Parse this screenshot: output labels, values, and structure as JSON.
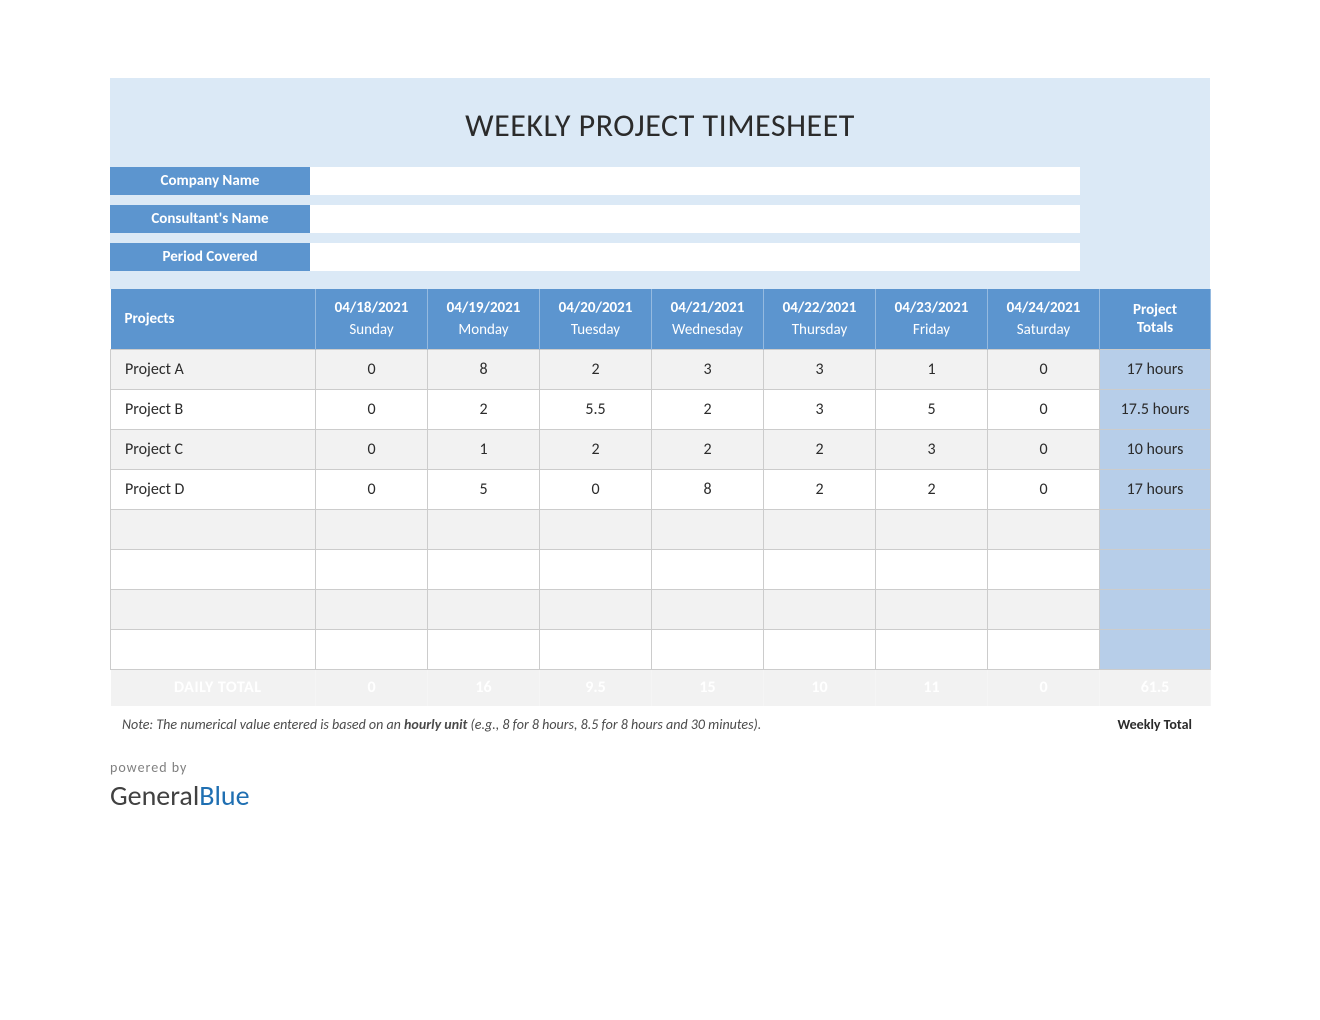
{
  "title": "WEEKLY PROJECT TIMESHEET",
  "meta": {
    "company_label": "Company Name",
    "consultant_label": "Consultant's Name",
    "period_label": "Period Covered",
    "company_value": "",
    "consultant_value": "",
    "period_value": ""
  },
  "table": {
    "projects_header": "Projects",
    "project_totals_header": "Project\nTotals",
    "columns": [
      {
        "date": "04/18/2021",
        "day": "Sunday"
      },
      {
        "date": "04/19/2021",
        "day": "Monday"
      },
      {
        "date": "04/20/2021",
        "day": "Tuesday"
      },
      {
        "date": "04/21/2021",
        "day": "Wednesday"
      },
      {
        "date": "04/22/2021",
        "day": "Thursday"
      },
      {
        "date": "04/23/2021",
        "day": "Friday"
      },
      {
        "date": "04/24/2021",
        "day": "Saturday"
      }
    ],
    "rows": [
      {
        "name": "Project A",
        "v": [
          "0",
          "8",
          "2",
          "3",
          "3",
          "1",
          "0"
        ],
        "total": "17 hours"
      },
      {
        "name": "Project B",
        "v": [
          "0",
          "2",
          "5.5",
          "2",
          "3",
          "5",
          "0"
        ],
        "total": "17.5 hours"
      },
      {
        "name": "Project C",
        "v": [
          "0",
          "1",
          "2",
          "2",
          "2",
          "3",
          "0"
        ],
        "total": "10 hours"
      },
      {
        "name": "Project D",
        "v": [
          "0",
          "5",
          "0",
          "8",
          "2",
          "2",
          "0"
        ],
        "total": "17 hours"
      },
      {
        "name": "",
        "v": [
          "",
          "",
          "",
          "",
          "",
          "",
          ""
        ],
        "total": ""
      },
      {
        "name": "",
        "v": [
          "",
          "",
          "",
          "",
          "",
          "",
          ""
        ],
        "total": ""
      },
      {
        "name": "",
        "v": [
          "",
          "",
          "",
          "",
          "",
          "",
          ""
        ],
        "total": ""
      },
      {
        "name": "",
        "v": [
          "",
          "",
          "",
          "",
          "",
          "",
          ""
        ],
        "total": ""
      }
    ],
    "daily_total_label": "DAILY TOTAL",
    "daily_totals": [
      "0",
      "16",
      "9.5",
      "15",
      "10",
      "11",
      "0"
    ],
    "weekly_total": "61.5"
  },
  "note_prefix": "Note: The numerical value entered is based on an ",
  "note_bold": "hourly unit",
  "note_suffix": " (e.g., 8 for 8 hours, 8.5 for 8 hours and 30 minutes).",
  "weekly_total_label": "Weekly Total",
  "powered_by": "powered by",
  "logo_general": "General",
  "logo_blue": "Blue"
}
